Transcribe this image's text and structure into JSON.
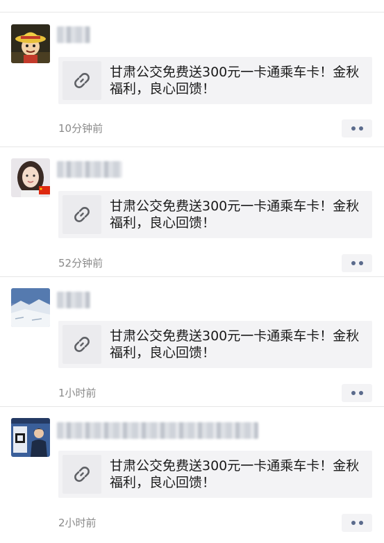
{
  "posts": [
    {
      "avatar_icon": "straw-hat-character-avatar",
      "link_text": "甘肃公交免费送300元一卡通乘车卡！金秋福利，良心回馈！",
      "time": "10分钟前"
    },
    {
      "avatar_icon": "woman-portrait-avatar",
      "link_text": "甘肃公交免费送300元一卡通乘车卡！金秋福利，良心回馈！",
      "time": "52分钟前"
    },
    {
      "avatar_icon": "snowy-landscape-avatar",
      "link_text": "甘肃公交免费送300元一卡通乘车卡！金秋福利，良心回馈！",
      "time": "1小时前"
    },
    {
      "avatar_icon": "presenter-qr-avatar",
      "link_text": "甘肃公交免费送300元一卡通乘车卡！金秋福利，良心回馈！",
      "time": "2小时前"
    }
  ],
  "icons": {
    "link": "link-icon",
    "more": "more-dots-icon",
    "flag": "china-flag-icon"
  },
  "colors": {
    "card_bg": "#f3f3f5",
    "timestamp": "#8a8a8a",
    "more_dots": "#5b6b8c",
    "divider": "#e6e6e6"
  }
}
